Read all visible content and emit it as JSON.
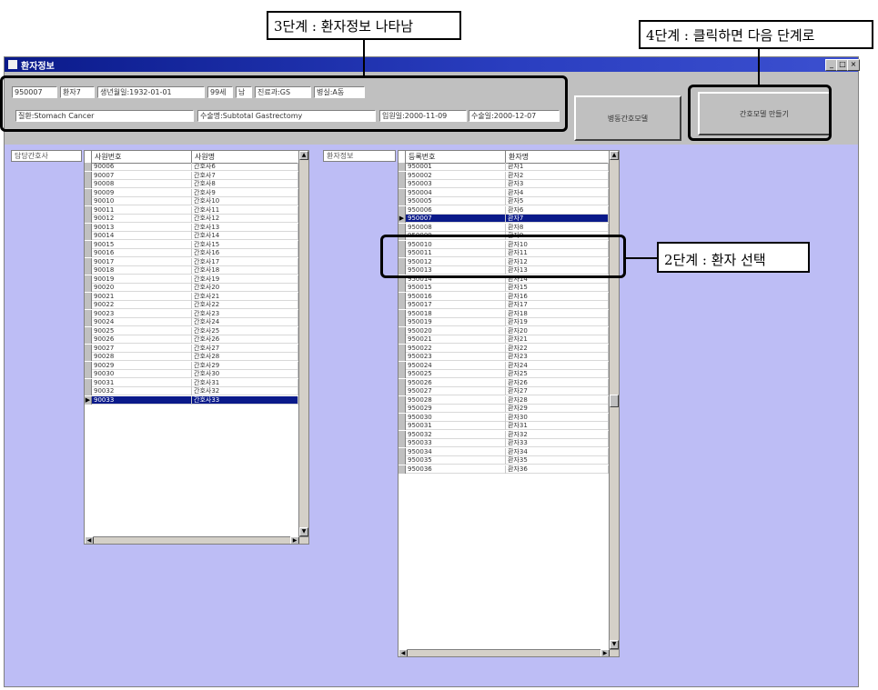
{
  "annotations": {
    "step3": "3단계 : 환자정보 나타남",
    "step4": "4단계 : 클릭하면 다음 단계로",
    "step2": "2단계 : 환자 선택"
  },
  "window": {
    "title": "환자정보",
    "controls": [
      "_",
      "□",
      "×"
    ]
  },
  "patient_info": {
    "row1": [
      "950007",
      "환자7",
      "생년월일:1932-01-01",
      "99세",
      "남",
      "진료과:GS",
      "병실:A동"
    ],
    "row2": [
      "질환:Stomach Cancer",
      "수술명:Subtotal Gastrectomy",
      "입원일:2000-11-09",
      "수술일:2000-12-07"
    ]
  },
  "buttons": {
    "nursing_record": "병동간호모델",
    "make_model": "간호모델 만들기"
  },
  "left_panel": {
    "tab": "담당간호사",
    "columns": [
      "사원번호",
      "사원명"
    ],
    "rows": [
      [
        "90006",
        "간호사6"
      ],
      [
        "90007",
        "간호사7"
      ],
      [
        "90008",
        "간호사8"
      ],
      [
        "90009",
        "간호사9"
      ],
      [
        "90010",
        "간호사10"
      ],
      [
        "90011",
        "간호사11"
      ],
      [
        "90012",
        "간호사12"
      ],
      [
        "90013",
        "간호사13"
      ],
      [
        "90014",
        "간호사14"
      ],
      [
        "90015",
        "간호사15"
      ],
      [
        "90016",
        "간호사16"
      ],
      [
        "90017",
        "간호사17"
      ],
      [
        "90018",
        "간호사18"
      ],
      [
        "90019",
        "간호사19"
      ],
      [
        "90020",
        "간호사20"
      ],
      [
        "90021",
        "간호사21"
      ],
      [
        "90022",
        "간호사22"
      ],
      [
        "90023",
        "간호사23"
      ],
      [
        "90024",
        "간호사24"
      ],
      [
        "90025",
        "간호사25"
      ],
      [
        "90026",
        "간호사26"
      ],
      [
        "90027",
        "간호사27"
      ],
      [
        "90028",
        "간호사28"
      ],
      [
        "90029",
        "간호사29"
      ],
      [
        "90030",
        "간호사30"
      ],
      [
        "90031",
        "간호사31"
      ],
      [
        "90032",
        "간호사32"
      ],
      [
        "90033",
        "간호사33"
      ]
    ],
    "selected_index": 27
  },
  "right_panel": {
    "tab": "환자정보",
    "columns": [
      "등록번호",
      "환자명"
    ],
    "rows": [
      [
        "950001",
        "환자1"
      ],
      [
        "950002",
        "환자2"
      ],
      [
        "950003",
        "환자3"
      ],
      [
        "950004",
        "환자4"
      ],
      [
        "950005",
        "환자5"
      ],
      [
        "950006",
        "환자6"
      ],
      [
        "950007",
        "환자7"
      ],
      [
        "950008",
        "환자8"
      ],
      [
        "950009",
        "환자9"
      ],
      [
        "950010",
        "환자10"
      ],
      [
        "950011",
        "환자11"
      ],
      [
        "950012",
        "환자12"
      ],
      [
        "950013",
        "환자13"
      ],
      [
        "950014",
        "환자14"
      ],
      [
        "950015",
        "환자15"
      ],
      [
        "950016",
        "환자16"
      ],
      [
        "950017",
        "환자17"
      ],
      [
        "950018",
        "환자18"
      ],
      [
        "950019",
        "환자19"
      ],
      [
        "950020",
        "환자20"
      ],
      [
        "950021",
        "환자21"
      ],
      [
        "950022",
        "환자22"
      ],
      [
        "950023",
        "환자23"
      ],
      [
        "950024",
        "환자24"
      ],
      [
        "950025",
        "환자25"
      ],
      [
        "950026",
        "환자26"
      ],
      [
        "950027",
        "환자27"
      ],
      [
        "950028",
        "환자28"
      ],
      [
        "950029",
        "환자29"
      ],
      [
        "950030",
        "환자30"
      ],
      [
        "950031",
        "환자31"
      ],
      [
        "950032",
        "환자32"
      ],
      [
        "950033",
        "환자33"
      ],
      [
        "950034",
        "환자34"
      ],
      [
        "950035",
        "환자35"
      ],
      [
        "950036",
        "환자36"
      ]
    ],
    "selected_index": 6
  }
}
